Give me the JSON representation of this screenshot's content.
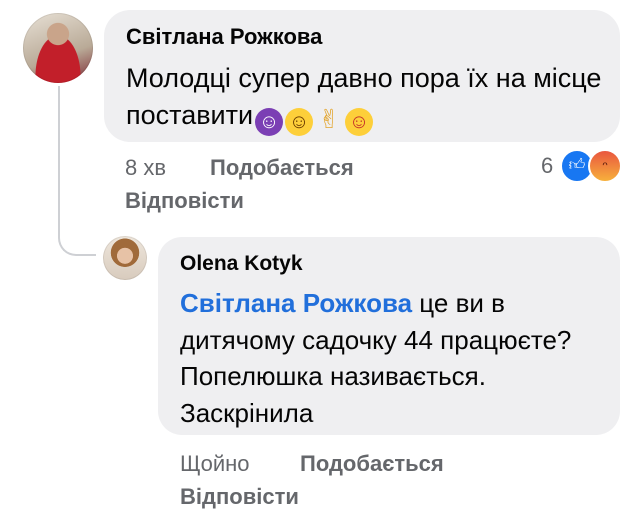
{
  "comment": {
    "author": "Світлана Рожкова",
    "text": "Молодці супер давно пора їх на місце поставити",
    "emojis": [
      "smiling-devil",
      "grinning-face",
      "victory-hand",
      "face-with-tongue"
    ],
    "time": "8 хв",
    "like_label": "Подобається",
    "reply_label": "Відповісти",
    "reaction_count": "6",
    "reactions": [
      "like",
      "angry"
    ]
  },
  "reply": {
    "author": "Olena Kotyk",
    "mention": "Світлана Рожкова",
    "text": " це ви в дитячому садочку 44 працюєте? Попелюшка називається. Заскрінила",
    "time": "Щойно",
    "like_label": "Подобається",
    "reply_label": "Відповісти"
  }
}
